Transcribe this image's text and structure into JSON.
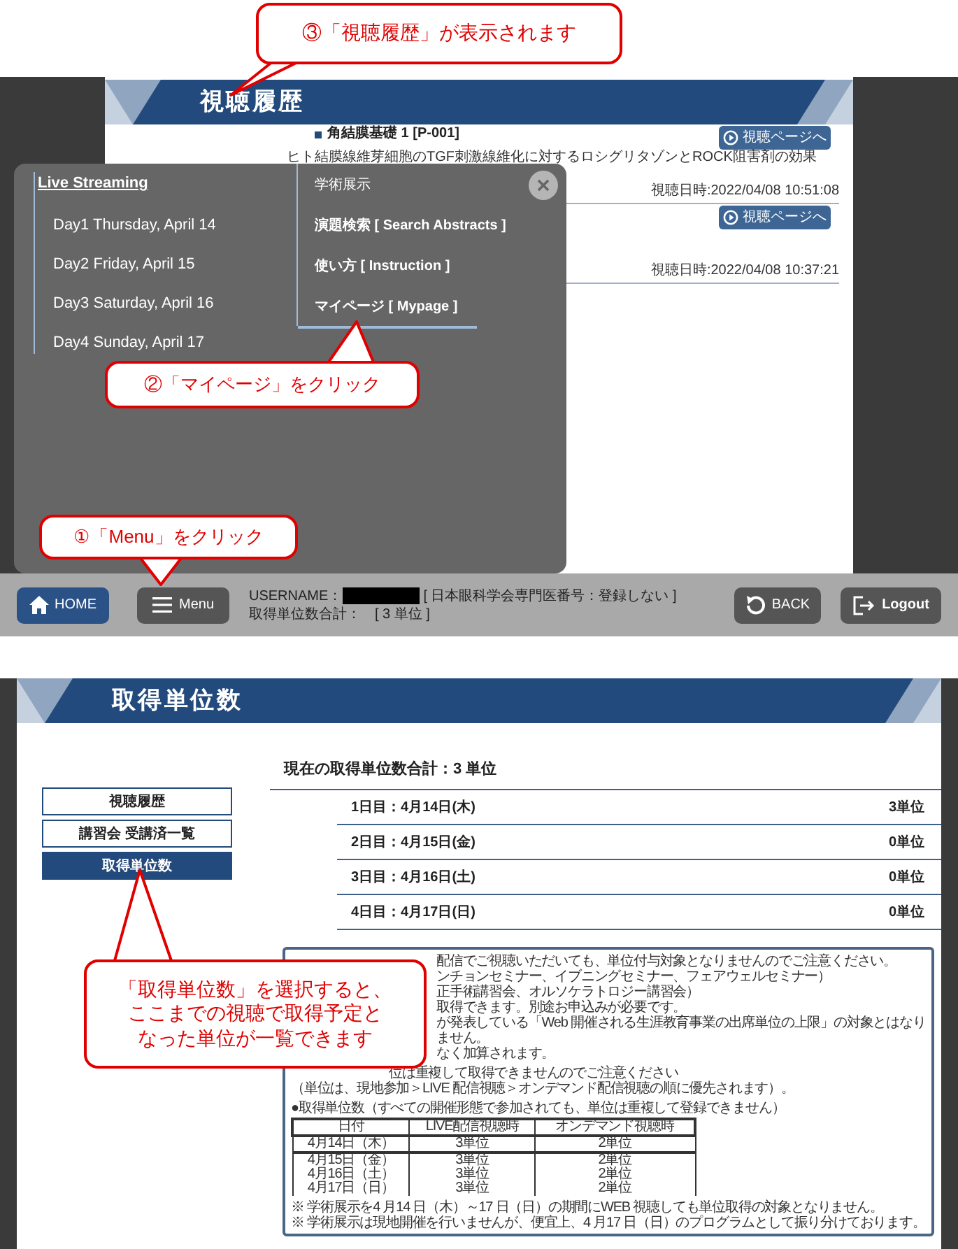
{
  "viewing_history_screen": {
    "header": "視聴履歴",
    "entries": [
      {
        "title": "角結膜基礎 1 [P-001]",
        "subtitle": "ヒト結膜線維芽細胞のTGF刺激線維化に対するロシグリタゾンとROCK阻害剤の効果",
        "button": "視聴ページへ",
        "timestamp": "視聴日時:2022/04/08 10:51:08"
      },
      {
        "button": "視聴ページへ",
        "timestamp": "視聴日時:2022/04/08 10:37:21"
      }
    ],
    "menu": {
      "live_heading": "Live Streaming",
      "days": [
        "Day1 Thursday, April 14",
        "Day2 Friday, April 15",
        "Day3 Saturday, April 16",
        "Day4 Sunday, April 17"
      ],
      "section_label": "学術展示",
      "links": [
        {
          "label": "演題検索 [ Search Abstracts ]",
          "selected": false
        },
        {
          "label": "使い方 [ Instruction ]",
          "selected": false
        },
        {
          "label": "マイページ [ Mypage ]",
          "selected": true
        }
      ]
    },
    "bottom_bar": {
      "home": "HOME",
      "menu": "Menu",
      "username_label": "USERNAME：",
      "member_number": "[ 日本眼科学会専門医番号：登録しない ]",
      "total_label": "取得単位数合計：　[ 3 単位 ]",
      "back": "BACK",
      "logout": "Logout"
    },
    "callouts": [
      "③「視聴履歴」が表示されます",
      "②「マイページ」をクリック",
      "①「Menu」をクリック"
    ]
  },
  "credits_screen": {
    "header": "取得単位数",
    "side_nav": [
      {
        "label": "視聴履歴",
        "selected": false
      },
      {
        "label": "講習会 受講済一覧",
        "selected": false
      },
      {
        "label": "取得単位数",
        "selected": true
      }
    ],
    "total": "現在の取得単位数合計：3 単位",
    "days": [
      {
        "label": "1日目：4月14日(木)",
        "units": "3単位"
      },
      {
        "label": "2日目：4月15日(金)",
        "units": "0単位"
      },
      {
        "label": "3日目：4月16日(土)",
        "units": "0単位"
      },
      {
        "label": "4日目：4月17日(日)",
        "units": "0単位"
      }
    ],
    "notice": {
      "partial_lines": [
        "配信でご視聴いただいても、単位付与対象となりませんのでご注意ください。",
        "ンチョンセミナー、イブニングセミナー、フェアウェルセミナー）",
        "正手術講習会、オルソケラトロジー講習会）",
        "取得できます。別途お申込みが必要です。",
        "が発表している「Web 開催される生涯教育事業の出席単位の上限」の対象とはなりません。",
        "なく加算されます。"
      ],
      "lines": [
        "位は重複して取得できませんのでご注意ください",
        "（単位は、現地参加＞LIVE 配信視聴＞オンデマンド配信視聴の順に優先されます）。"
      ],
      "table_title": "●取得単位数（すべての開催形態で参加されても、単位は重複して登録できません）",
      "table": {
        "columns": [
          "日付",
          "LIVE配信視聴時",
          "オンデマンド視聴時"
        ],
        "rows": [
          [
            "4月14日（木）",
            "3単位",
            "2単位"
          ],
          [
            "4月15日（金）",
            "3単位",
            "2単位"
          ],
          [
            "4月16日（土）",
            "3単位",
            "2単位"
          ],
          [
            "4月17日（日）",
            "3単位",
            "2単位"
          ]
        ]
      },
      "footnotes": [
        "※ 学術展示を4 月14 日（木）～17 日（日）の期間にWEB 視聴しても単位取得の対象となりません。",
        "※ 学術展示は現地開催を行いませんが、便宜上、4 月17 日（日）のプログラムとして振り分けております。"
      ]
    },
    "callout": [
      "「取得単位数」を選択すると、",
      "ここまでの視聴で取得予定と",
      "なった単位が一覧できます"
    ]
  }
}
